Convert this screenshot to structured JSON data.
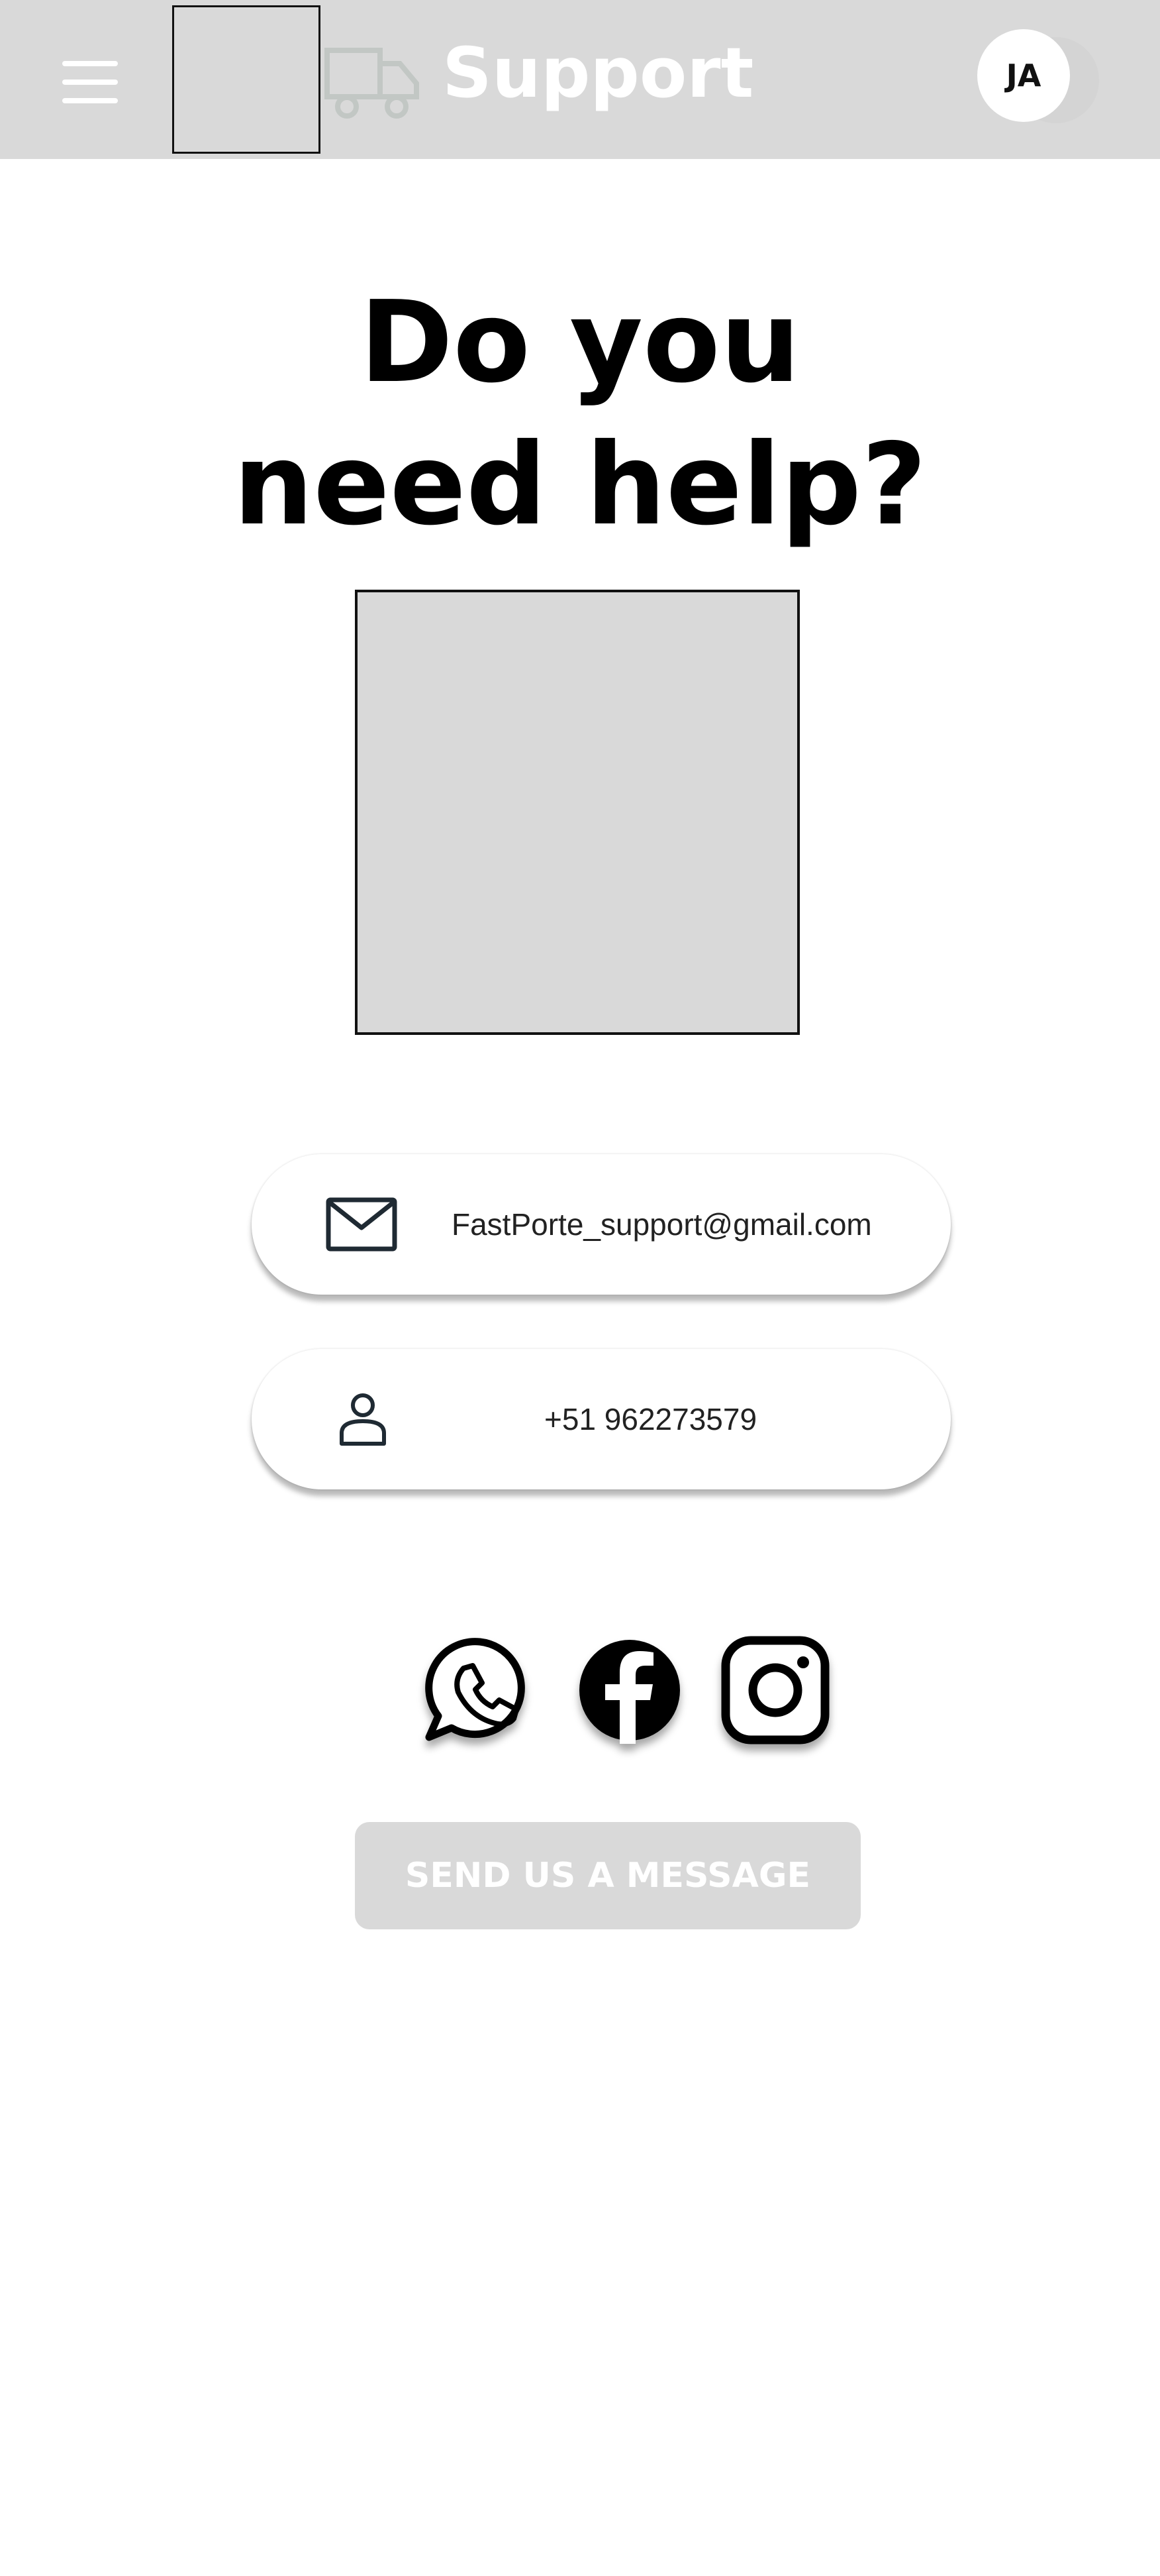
{
  "header": {
    "title": "Support",
    "avatar_initials": "JA",
    "menu_icon": "hamburger-menu-icon",
    "background": "#d9d9d9"
  },
  "main": {
    "headline_line1": "Do you",
    "headline_line2": "need help?"
  },
  "contacts": {
    "email": {
      "icon": "mail-icon",
      "value": "FastPorte_support@gmail.com"
    },
    "phone": {
      "icon": "person-icon",
      "value": "+51 962273579"
    }
  },
  "social": [
    {
      "icon": "whatsapp-icon"
    },
    {
      "icon": "facebook-icon"
    },
    {
      "icon": "instagram-icon"
    }
  ],
  "actions": {
    "send_label": "SEND US A MESSAGE"
  }
}
